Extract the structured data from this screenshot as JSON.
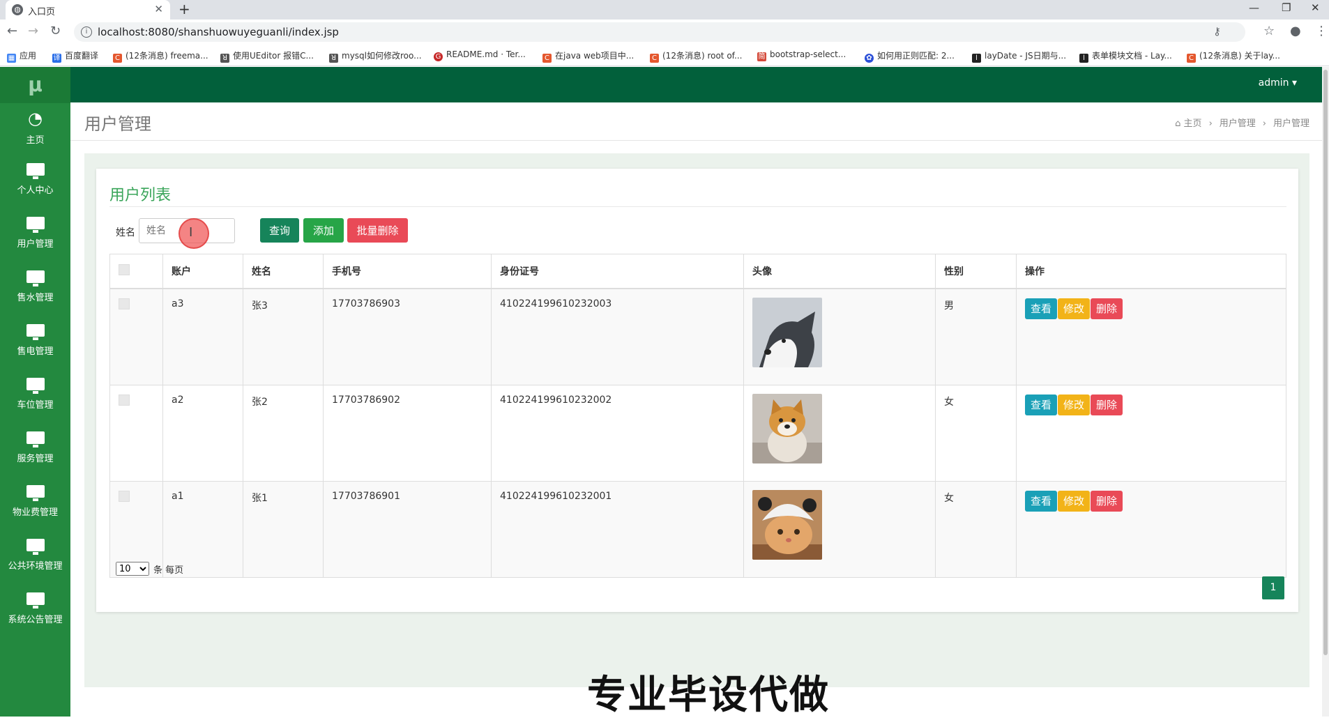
{
  "browser": {
    "tab_title": "入口页",
    "url": "localhost:8080/shanshuowuyeguanli/index.jsp",
    "bookmarks": [
      {
        "label": "应用",
        "color": "#4285f4"
      },
      {
        "label": "百度翻译",
        "color": "#2a6ee8"
      },
      {
        "label": "(12条消息) freema...",
        "color": "#e4572e"
      },
      {
        "label": "使用UEditor 报错C...",
        "color": "#555555"
      },
      {
        "label": "mysql如何修改roo...",
        "color": "#555555"
      },
      {
        "label": "README.md · Ter...",
        "color": "#c62828"
      },
      {
        "label": "在java web项目中...",
        "color": "#e4572e"
      },
      {
        "label": "(12条消息) root of...",
        "color": "#e4572e"
      },
      {
        "label": "bootstrap-select...",
        "color": "#d44a3a"
      },
      {
        "label": "如何用正则匹配: 2...",
        "color": "#2b4fd8"
      },
      {
        "label": "layDate - JS日期与...",
        "color": "#222222"
      },
      {
        "label": "表单模块文档 - Lay...",
        "color": "#222222"
      },
      {
        "label": "(12条消息) 关于lay...",
        "color": "#e4572e"
      }
    ]
  },
  "app": {
    "logo": "μ",
    "user": "admin ▾",
    "nav": [
      {
        "label": "主页",
        "icon": "dashboard-icon"
      },
      {
        "label": "个人中心",
        "icon": "monitor-icon"
      },
      {
        "label": "用户管理",
        "icon": "monitor-icon"
      },
      {
        "label": "售水管理",
        "icon": "monitor-icon"
      },
      {
        "label": "售电管理",
        "icon": "monitor-icon"
      },
      {
        "label": "车位管理",
        "icon": "monitor-icon"
      },
      {
        "label": "服务管理",
        "icon": "monitor-icon"
      },
      {
        "label": "物业费管理",
        "icon": "monitor-icon"
      },
      {
        "label": "公共环境管理",
        "icon": "monitor-icon"
      },
      {
        "label": "系统公告管理",
        "icon": "monitor-icon"
      }
    ],
    "colors": {
      "sidebar": "#23893f",
      "topbar": "#02603b",
      "accent": "#3aa55a"
    }
  },
  "page": {
    "title": "用户管理",
    "breadcrumb": [
      "主页",
      "用户管理",
      "用户管理"
    ],
    "list_title": "用户列表",
    "search": {
      "label": "姓名",
      "placeholder": "姓名",
      "value": ""
    },
    "buttons": {
      "query": "查询",
      "add": "添加",
      "batch_delete": "批量删除"
    },
    "table": {
      "columns": [
        "账户",
        "姓名",
        "手机号",
        "身份证号",
        "头像",
        "性别",
        "操作"
      ],
      "rows": [
        {
          "account": "a3",
          "name": "张3",
          "phone": "17703786903",
          "id_number": "410224199610232003",
          "avatar": "husky-dog-photo",
          "gender": "男"
        },
        {
          "account": "a2",
          "name": "张2",
          "phone": "17703786902",
          "id_number": "410224199610232002",
          "avatar": "shiba-dog-photo",
          "gender": "女"
        },
        {
          "account": "a1",
          "name": "张1",
          "phone": "17703786901",
          "id_number": "410224199610232001",
          "avatar": "cat-in-hat-photo",
          "gender": "女"
        }
      ],
      "actions": {
        "view": "查看",
        "edit": "修改",
        "delete": "删除"
      }
    },
    "page_size": {
      "value": "10",
      "label": "条 每页"
    },
    "current_page": "1"
  },
  "overlay": {
    "watermark": "专业毕设代做"
  }
}
